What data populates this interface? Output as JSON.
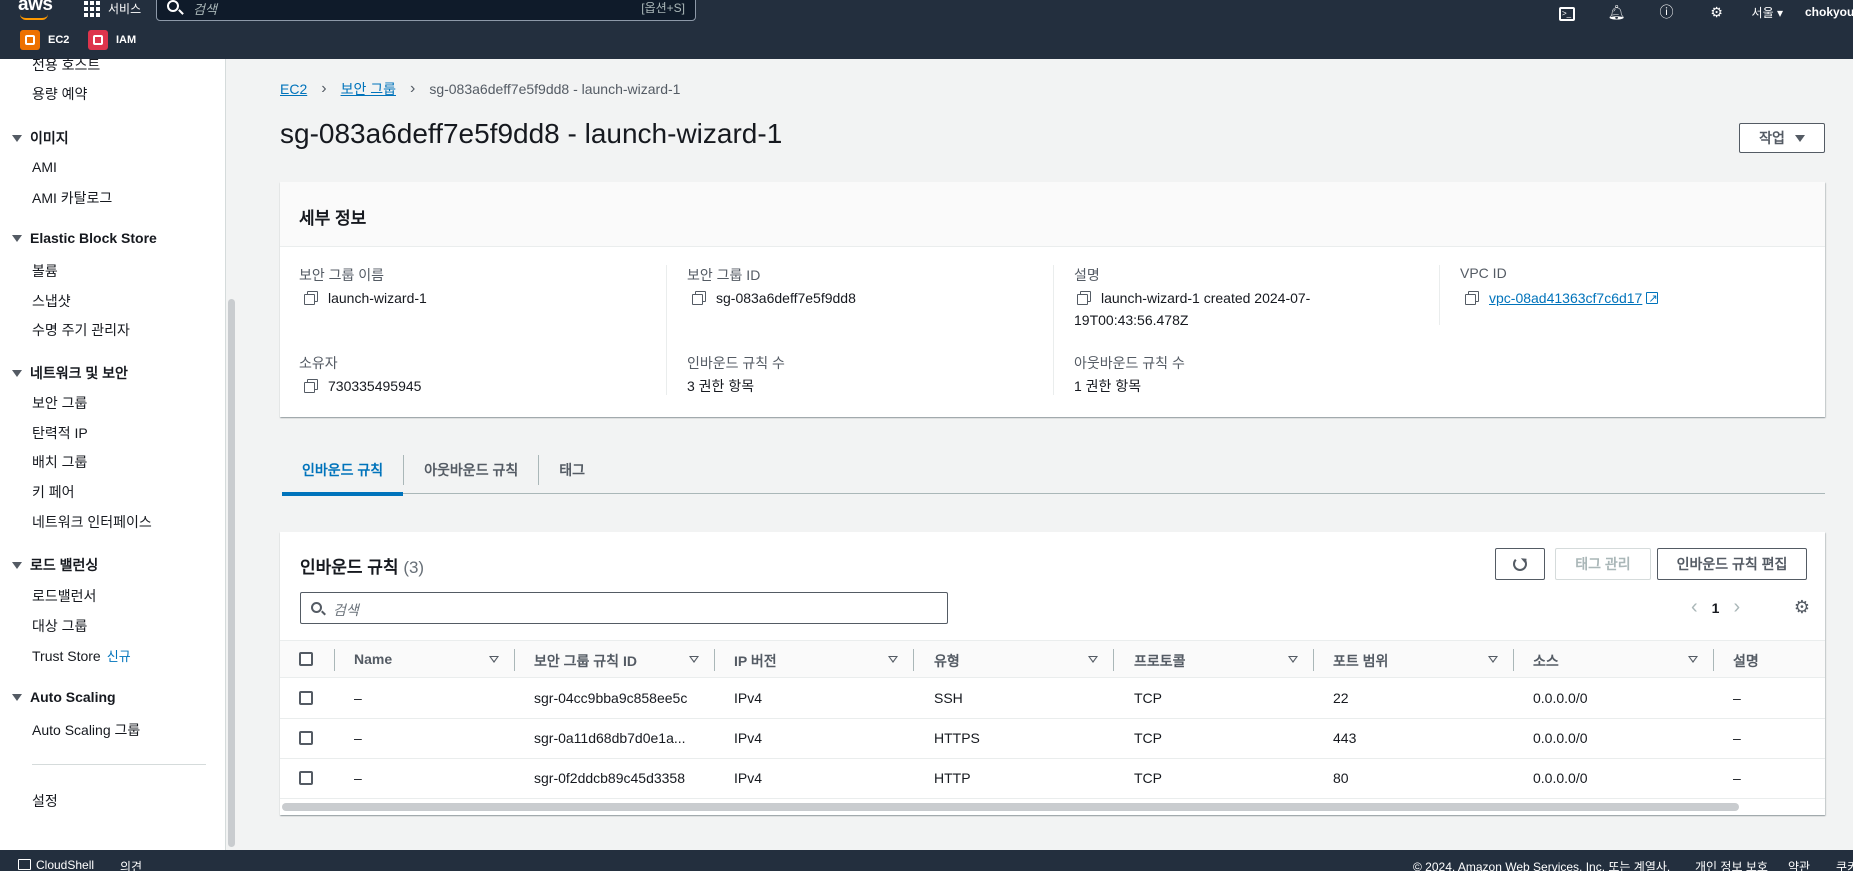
{
  "topnav": {
    "logo": "aws",
    "services_label": "서비스",
    "search_placeholder": "검색",
    "search_hint": "[옵션+S]",
    "region": "서울",
    "user": "chokyou",
    "favorites": [
      {
        "label": "EC2",
        "color": "#ed7100"
      },
      {
        "label": "IAM",
        "color": "#dd344c"
      }
    ]
  },
  "sidebar": {
    "items_top": [
      "전용 호스트",
      "용량 예약"
    ],
    "sections": [
      {
        "title": "이미지",
        "items": [
          "AMI",
          "AMI 카탈로그"
        ]
      },
      {
        "title": "Elastic Block Store",
        "items": [
          "볼륨",
          "스냅샷",
          "수명 주기 관리자"
        ]
      },
      {
        "title": "네트워크 및 보안",
        "items": [
          "보안 그룹",
          "탄력적 IP",
          "배치 그룹",
          "키 페어",
          "네트워크 인터페이스"
        ]
      },
      {
        "title": "로드 밸런싱",
        "items": [
          "로드밸런서",
          "대상 그룹",
          "Trust Store"
        ]
      },
      {
        "title": "Auto Scaling",
        "items": [
          "Auto Scaling 그룹"
        ]
      }
    ],
    "new_badge": "신규",
    "settings": "설정"
  },
  "breadcrumb": {
    "root": "EC2",
    "parent": "보안 그룹",
    "current": "sg-083a6deff7e5f9dd8 - launch-wizard-1"
  },
  "page": {
    "title": "sg-083a6deff7e5f9dd8 - launch-wizard-1",
    "action_label": "작업"
  },
  "details": {
    "title": "세부 정보",
    "sg_name_label": "보안 그룹 이름",
    "sg_name": "launch-wizard-1",
    "sg_id_label": "보안 그룹 ID",
    "sg_id": "sg-083a6deff7e5f9dd8",
    "desc_label": "설명",
    "desc_line1": "launch-wizard-1 created 2024-07-",
    "desc_line2": "19T00:43:56.478Z",
    "vpc_label": "VPC ID",
    "vpc_id": "vpc-08ad41363cf7c6d17",
    "owner_label": "소유자",
    "owner": "730335495945",
    "inbound_count_label": "인바운드 규칙 수",
    "inbound_count": "3 권한 항목",
    "outbound_count_label": "아웃바운드 규칙 수",
    "outbound_count": "1 권한 항목"
  },
  "tabs": [
    "인바운드 규칙",
    "아웃바운드 규칙",
    "태그"
  ],
  "rules": {
    "title": "인바운드 규칙",
    "count": "(3)",
    "manage_tags": "태그 관리",
    "edit_rules": "인바운드 규칙 편집",
    "search_placeholder": "검색",
    "page": "1",
    "columns": [
      "Name",
      "보안 그룹 규칙 ID",
      "IP 버전",
      "유형",
      "프로토콜",
      "포트 범위",
      "소스",
      "설명"
    ],
    "rows": [
      [
        "–",
        "sgr-04cc9bba9c858ee5c",
        "IPv4",
        "SSH",
        "TCP",
        "22",
        "0.0.0.0/0",
        "–"
      ],
      [
        "–",
        "sgr-0a11d68db7d0e1a...",
        "IPv4",
        "HTTPS",
        "TCP",
        "443",
        "0.0.0.0/0",
        "–"
      ],
      [
        "–",
        "sgr-0f2ddcb89c45d3358",
        "IPv4",
        "HTTP",
        "TCP",
        "80",
        "0.0.0.0/0",
        "–"
      ]
    ]
  },
  "footer": {
    "cloudshell": "CloudShell",
    "feedback": "의견",
    "copyright": "© 2024, Amazon Web Services, Inc. 또는 계열사.",
    "privacy": "개인 정보 보호",
    "terms": "약관",
    "cookie": "쿠키"
  }
}
